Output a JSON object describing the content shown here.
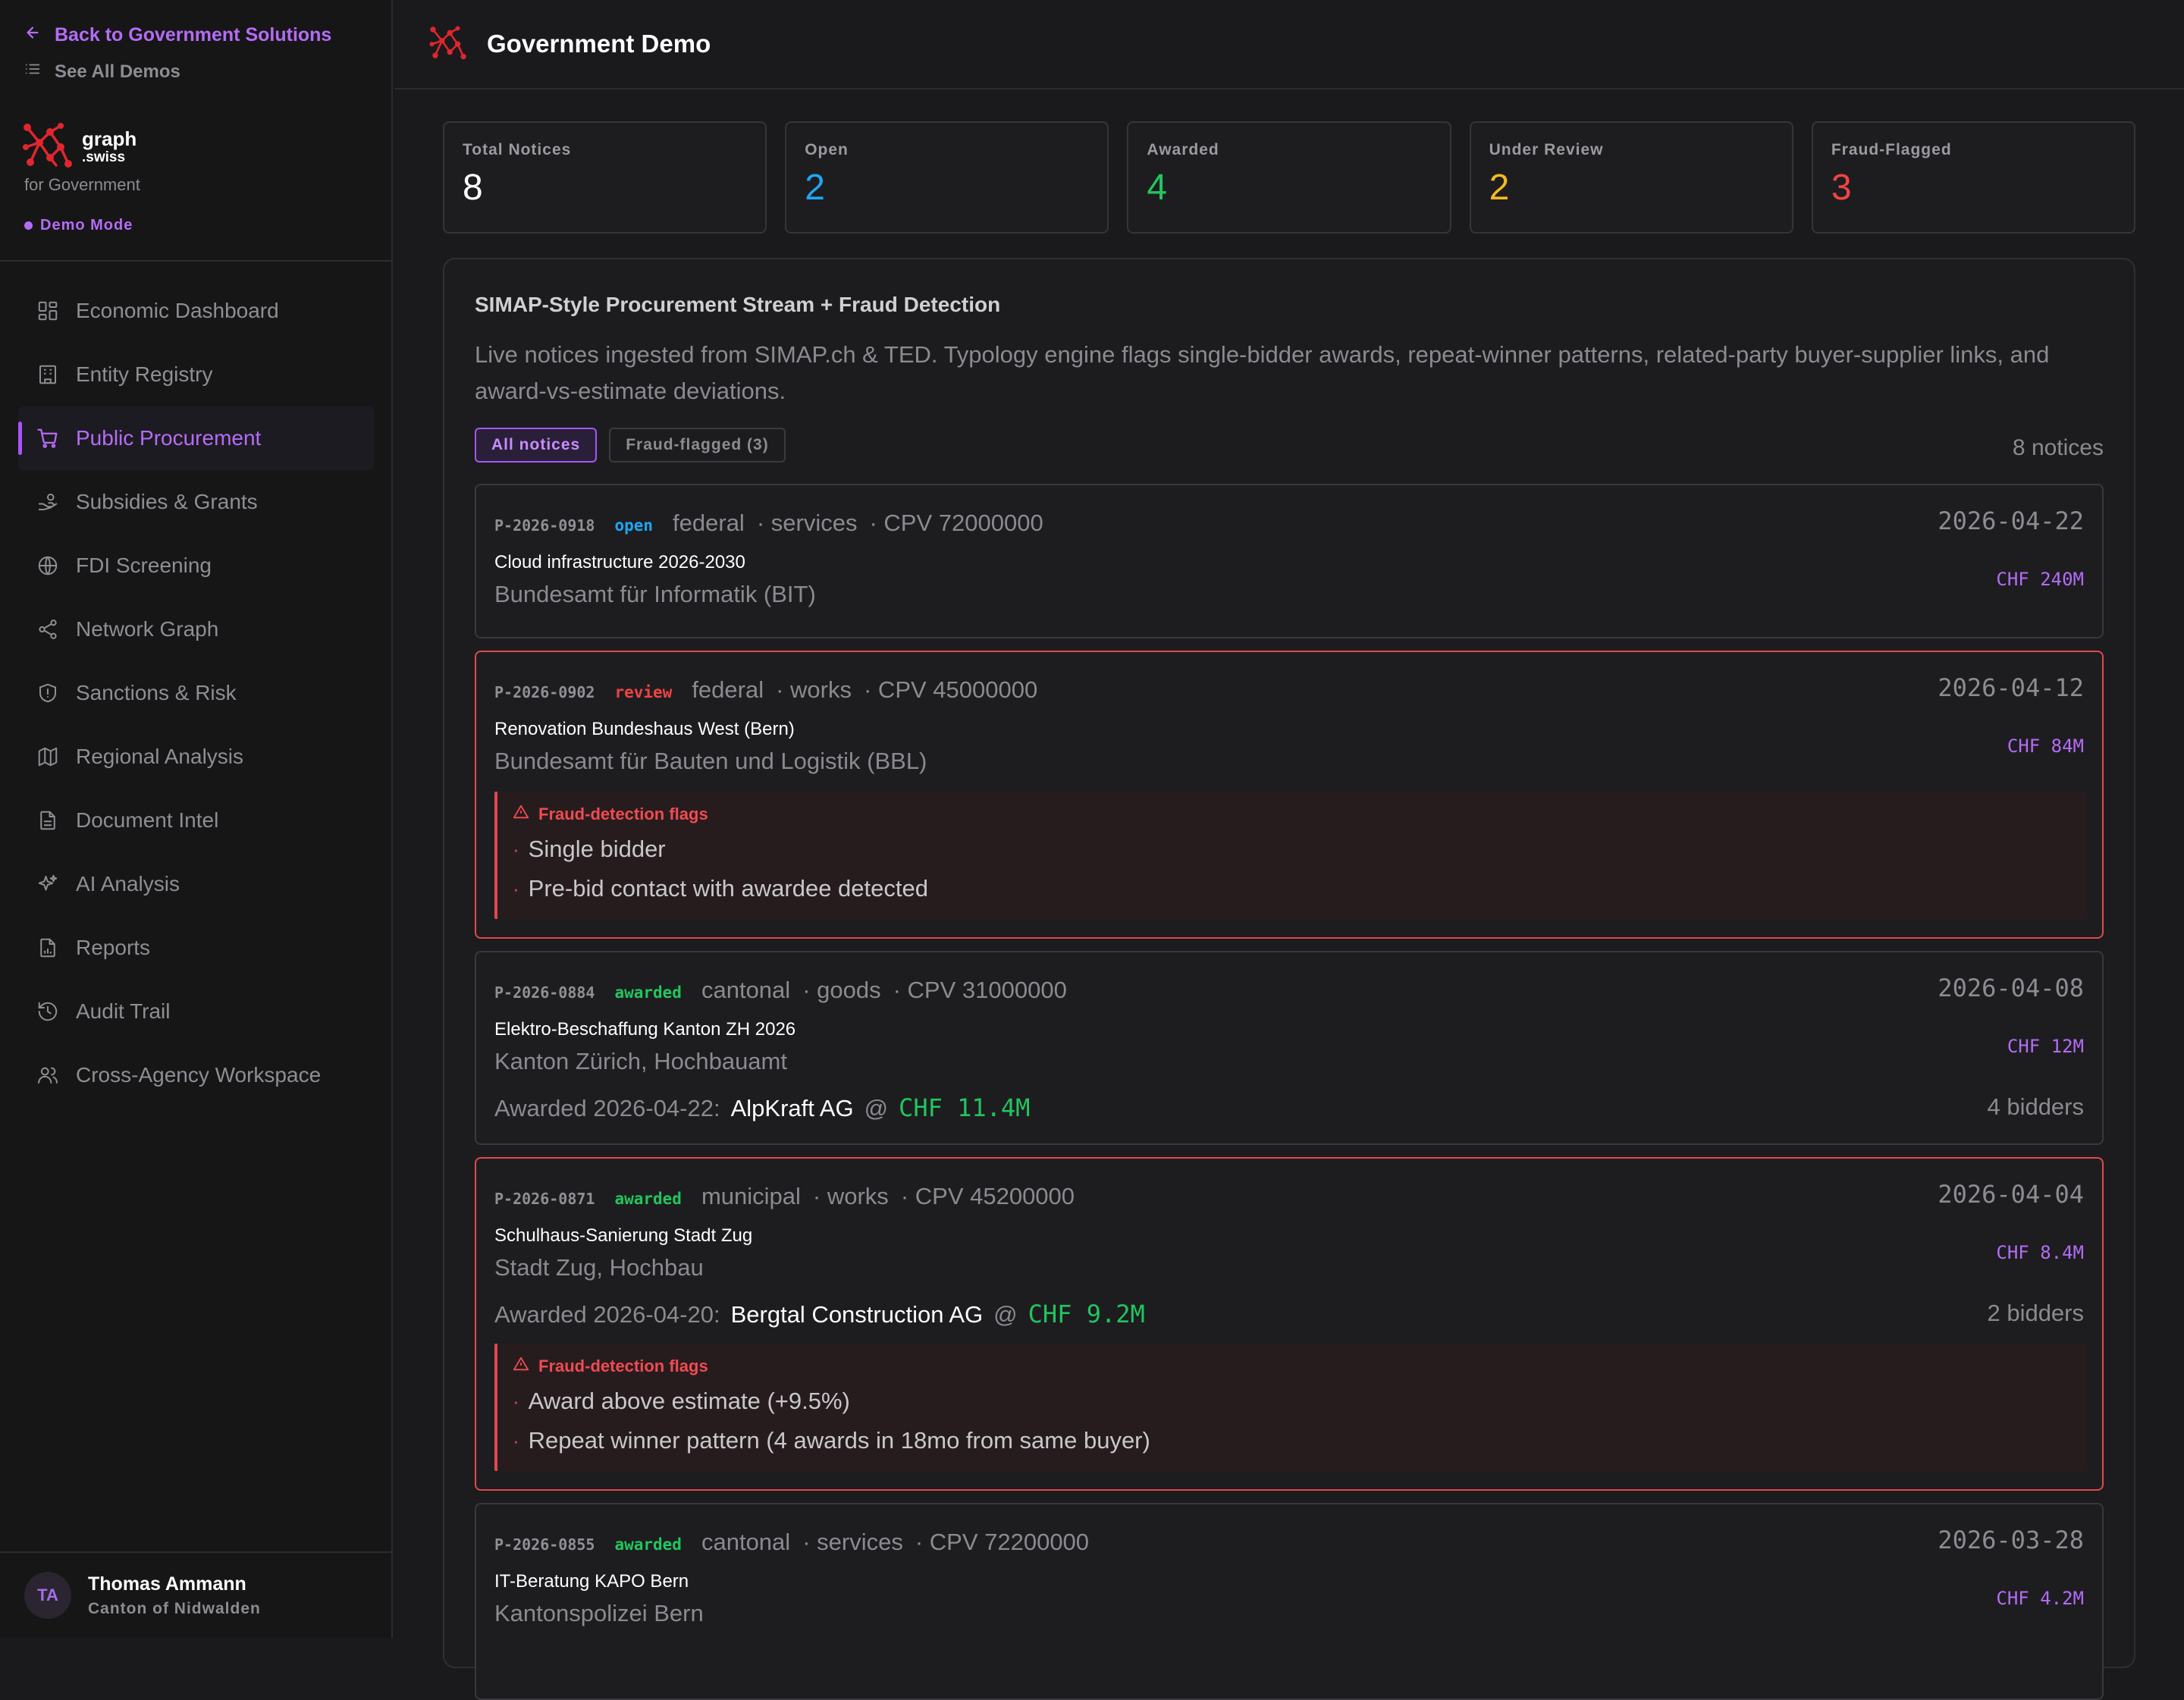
{
  "sidebar": {
    "back_label": "Back to Government Solutions",
    "see_all_label": "See All Demos",
    "brand_line1": "graph",
    "brand_line2": ".swiss",
    "brand_sub": "for Government",
    "demo_mode": "Demo Mode",
    "items": [
      {
        "label": "Economic Dashboard",
        "icon": "dashboard-icon"
      },
      {
        "label": "Entity Registry",
        "icon": "building-icon"
      },
      {
        "label": "Public Procurement",
        "icon": "cart-icon"
      },
      {
        "label": "Subsidies & Grants",
        "icon": "hand-coins-icon"
      },
      {
        "label": "FDI Screening",
        "icon": "globe-icon"
      },
      {
        "label": "Network Graph",
        "icon": "share-icon"
      },
      {
        "label": "Sanctions & Risk",
        "icon": "shield-icon"
      },
      {
        "label": "Regional Analysis",
        "icon": "map-icon"
      },
      {
        "label": "Document Intel",
        "icon": "document-icon"
      },
      {
        "label": "AI Analysis",
        "icon": "sparkles-icon"
      },
      {
        "label": "Reports",
        "icon": "report-icon"
      },
      {
        "label": "Audit Trail",
        "icon": "history-icon"
      },
      {
        "label": "Cross-Agency Workspace",
        "icon": "users-icon"
      }
    ],
    "active_index": 2,
    "user": {
      "initials": "TA",
      "name": "Thomas Ammann",
      "org": "Canton of Nidwalden"
    }
  },
  "header": {
    "title": "Government Demo"
  },
  "stats": [
    {
      "label": "Total Notices",
      "value": "8",
      "color": "#ffffff"
    },
    {
      "label": "Open",
      "value": "2",
      "color": "#1ea7f0"
    },
    {
      "label": "Awarded",
      "value": "4",
      "color": "#22c55e"
    },
    {
      "label": "Under Review",
      "value": "2",
      "color": "#f5b91e"
    },
    {
      "label": "Fraud-Flagged",
      "value": "3",
      "color": "#ef4444"
    }
  ],
  "panel": {
    "title": "SIMAP-Style Procurement Stream + Fraud Detection",
    "description": "Live notices ingested from SIMAP.ch & TED. Typology engine flags single-bidder awards, repeat-winner patterns, related-party buyer-supplier links, and award-vs-estimate deviations.",
    "filter_all": "All notices",
    "filter_flagged": "Fraud-flagged (3)",
    "count_label": "8 notices"
  },
  "fraud_heading": "Fraud-detection flags",
  "notices": [
    {
      "id": "P-2026-0918",
      "status": "open",
      "status_color": "#1ea7f0",
      "level": "federal",
      "category": "· services",
      "cpv": "· CPV 72000000",
      "date": "2026-04-22",
      "title": "Cloud infrastructure 2026-2030",
      "buyer": "Bundesamt für Informatik (BIT)",
      "value": "CHF 240M"
    },
    {
      "id": "P-2026-0902",
      "status": "review",
      "status_color": "#ef4444",
      "level": "federal",
      "category": "· works",
      "cpv": "· CPV 45000000",
      "date": "2026-04-12",
      "title": "Renovation Bundeshaus West (Bern)",
      "buyer": "Bundesamt für Bauten und Logistik (BBL)",
      "value": "CHF 84M",
      "flags": [
        "Single bidder",
        "Pre-bid contact with awardee detected"
      ]
    },
    {
      "id": "P-2026-0884",
      "status": "awarded",
      "status_color": "#22c55e",
      "level": "cantonal",
      "category": "· goods",
      "cpv": "· CPV 31000000",
      "date": "2026-04-08",
      "title": "Elektro-Beschaffung Kanton ZH 2026",
      "buyer": "Kanton Zürich, Hochbauamt",
      "value": "CHF 12M",
      "award_prefix": "Awarded 2026-04-22:",
      "supplier": "AlpKraft AG",
      "at": "@",
      "amount": "CHF 11.4M",
      "bidders": "4 bidders"
    },
    {
      "id": "P-2026-0871",
      "status": "awarded",
      "status_color": "#22c55e",
      "level": "municipal",
      "category": "· works",
      "cpv": "· CPV 45200000",
      "date": "2026-04-04",
      "title": "Schulhaus-Sanierung Stadt Zug",
      "buyer": "Stadt Zug, Hochbau",
      "value": "CHF 8.4M",
      "award_prefix": "Awarded 2026-04-20:",
      "supplier": "Bergtal Construction AG",
      "at": "@",
      "amount": "CHF 9.2M",
      "bidders": "2 bidders",
      "flags": [
        "Award above estimate (+9.5%)",
        "Repeat winner pattern (4 awards in 18mo from same buyer)"
      ]
    },
    {
      "id": "P-2026-0855",
      "status": "awarded",
      "status_color": "#22c55e",
      "level": "cantonal",
      "category": "· services",
      "cpv": "· CPV 72200000",
      "date": "2026-03-28",
      "title": "IT-Beratung KAPO Bern",
      "buyer": "Kantonspolizei Bern",
      "value": "CHF 4.2M"
    }
  ]
}
